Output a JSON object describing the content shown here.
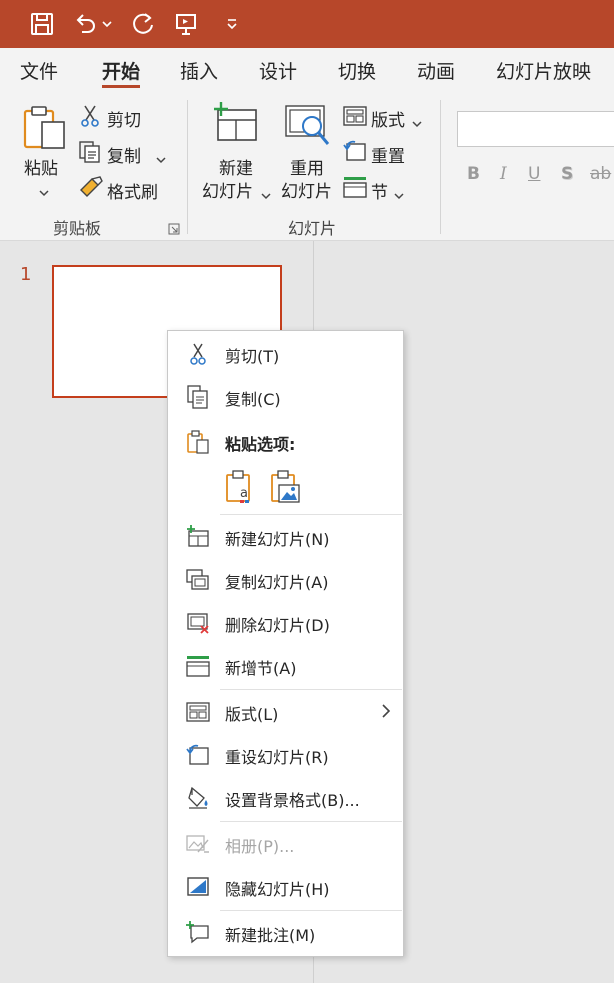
{
  "colors": {
    "accent": "#b7472a",
    "slide_border": "#c43e1c",
    "green": "#2e9e48",
    "blue": "#2e78c8",
    "red": "#e03a3a"
  },
  "qat": [
    {
      "name": "save-icon"
    },
    {
      "name": "undo-icon"
    },
    {
      "name": "redo-icon"
    },
    {
      "name": "present-icon"
    },
    {
      "name": "customize-qat-icon"
    }
  ],
  "tabs": [
    "文件",
    "开始",
    "插入",
    "设计",
    "切换",
    "动画",
    "幻灯片放映"
  ],
  "ribbon": {
    "clipboard": {
      "paste": "粘贴",
      "cut": "剪切",
      "copy": "复制",
      "format_painter": "格式刷",
      "group": "剪贴板"
    },
    "slides": {
      "new_slide_1": "新建",
      "new_slide_2": "幻灯片",
      "reuse_1": "重用",
      "reuse_2": "幻灯片",
      "layout": "版式",
      "reset": "重置",
      "section": "节",
      "group": "幻灯片"
    },
    "font": {
      "bold": "B",
      "italic": "I",
      "underline": "U",
      "shadow": "S",
      "strike": "ab"
    }
  },
  "thumbnail": {
    "number": "1"
  },
  "context_menu": {
    "cut": "剪切(T)",
    "copy": "复制(C)",
    "paste_options": "粘贴选项:",
    "new_slide": "新建幻灯片(N)",
    "duplicate_slide": "复制幻灯片(A)",
    "delete_slide": "删除幻灯片(D)",
    "add_section": "新增节(A)",
    "layout": "版式(L)",
    "reset_slide": "重设幻灯片(R)",
    "format_background": "设置背景格式(B)...",
    "photo_album": "相册(P)...",
    "hide_slide": "隐藏幻灯片(H)",
    "new_comment": "新建批注(M)"
  }
}
